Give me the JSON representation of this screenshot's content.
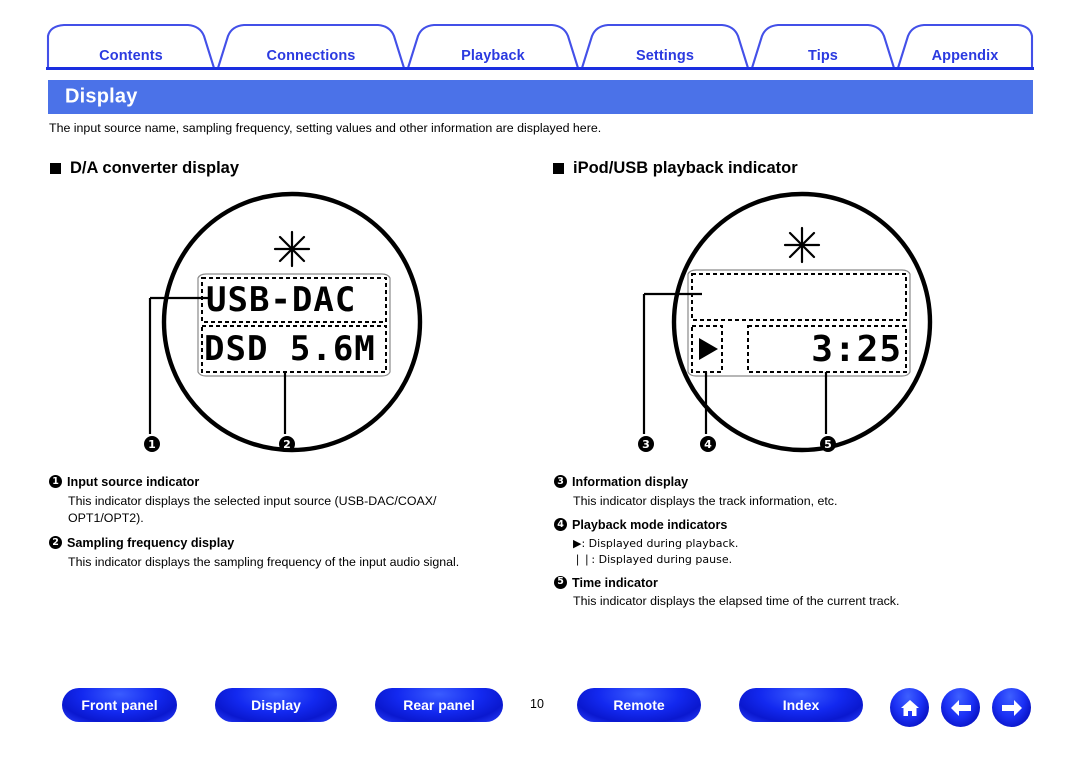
{
  "nav": {
    "tabs": [
      {
        "label": "Contents"
      },
      {
        "label": "Connections"
      },
      {
        "label": "Playback"
      },
      {
        "label": "Settings"
      },
      {
        "label": "Tips"
      },
      {
        "label": "Appendix"
      }
    ]
  },
  "header": {
    "title": "Display",
    "intro": "The input source name, sampling frequency, setting values and other information are displayed here."
  },
  "sections": {
    "left": {
      "heading": "D/A converter display"
    },
    "right": {
      "heading": "iPod/USB playback indicator"
    }
  },
  "figures": {
    "dac_display": {
      "line1": "USB-DAC",
      "line2": "DSD 5.6M",
      "callouts": [
        "1",
        "2"
      ],
      "sparkle_icon": "sparkle-icon"
    },
    "ipod_display": {
      "info_line": "",
      "play_icon": "play-icon",
      "time": "3:25",
      "callouts": [
        "3",
        "4",
        "5"
      ],
      "sparkle_icon": "sparkle-icon"
    }
  },
  "legend_left": [
    {
      "num": "1",
      "title": "Input source indicator",
      "lines": [
        "This indicator displays the selected input source (USB-DAC/COAX/",
        "OPT1/OPT2)."
      ]
    },
    {
      "num": "2",
      "title": "Sampling frequency display",
      "lines": [
        "This indicator displays the sampling frequency of the input audio signal."
      ]
    }
  ],
  "legend_right": [
    {
      "num": "3",
      "title": "Information display",
      "lines": [
        "This indicator displays the track information, etc."
      ]
    },
    {
      "num": "4",
      "title": "Playback mode indicators",
      "lines": [
        "▶: Displayed during playback.",
        "❘❘: Displayed during pause."
      ]
    },
    {
      "num": "5",
      "title": "Time indicator",
      "lines": [
        "This indicator displays the elapsed time of the current track."
      ]
    }
  ],
  "footer": {
    "buttons": [
      {
        "label": "Front panel"
      },
      {
        "label": "Display"
      },
      {
        "label": "Rear panel"
      },
      {
        "label": "Remote"
      },
      {
        "label": "Index"
      }
    ],
    "page_number": "10",
    "icons": [
      {
        "name": "home-icon"
      },
      {
        "name": "arrow-left-icon"
      },
      {
        "name": "arrow-right-icon"
      }
    ]
  },
  "colors": {
    "accent_blue": "#2b3ae0",
    "banner_blue": "#4b72e8",
    "button_blue": "#1329f0"
  }
}
